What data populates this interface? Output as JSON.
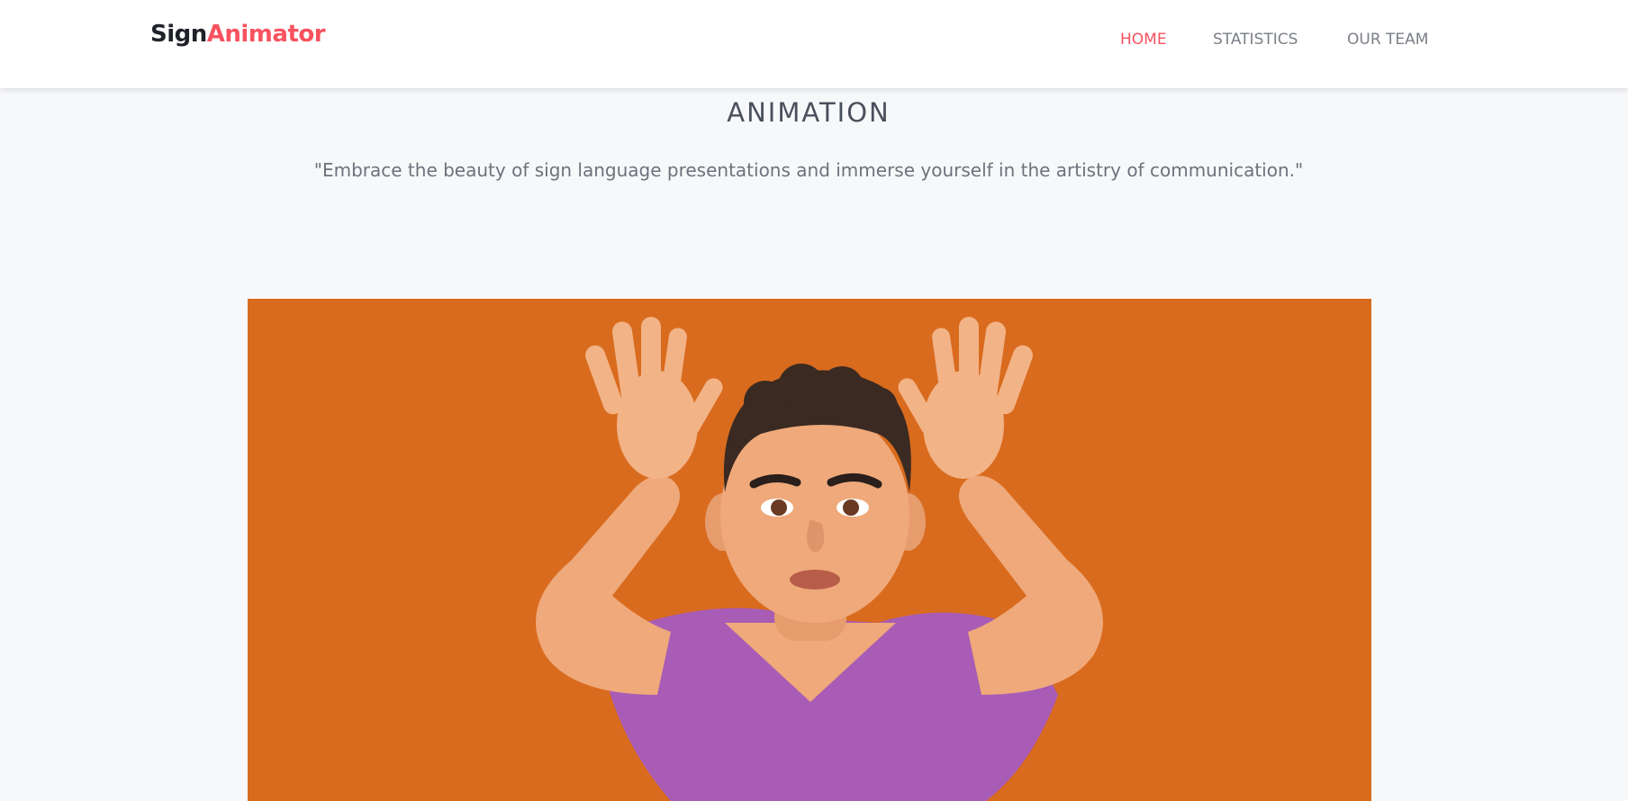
{
  "navbar": {
    "brand_part1": "Sign",
    "brand_part2": "Animator",
    "links": [
      {
        "label": "HOME",
        "active": true
      },
      {
        "label": "STATISTICS",
        "active": false
      },
      {
        "label": "OUR TEAM",
        "active": false
      }
    ]
  },
  "main": {
    "title": "ANIMATION",
    "quote": "\"Embrace the beauty of sign language presentations and immerse yourself in the artistry of communication.\""
  },
  "colors": {
    "accent": "#f7525f",
    "brand_dark": "#1f2229",
    "video_background": "#d96b1e",
    "shirt": "#a85cb5",
    "skin": "#efa97a",
    "hair": "#3a2a22"
  }
}
